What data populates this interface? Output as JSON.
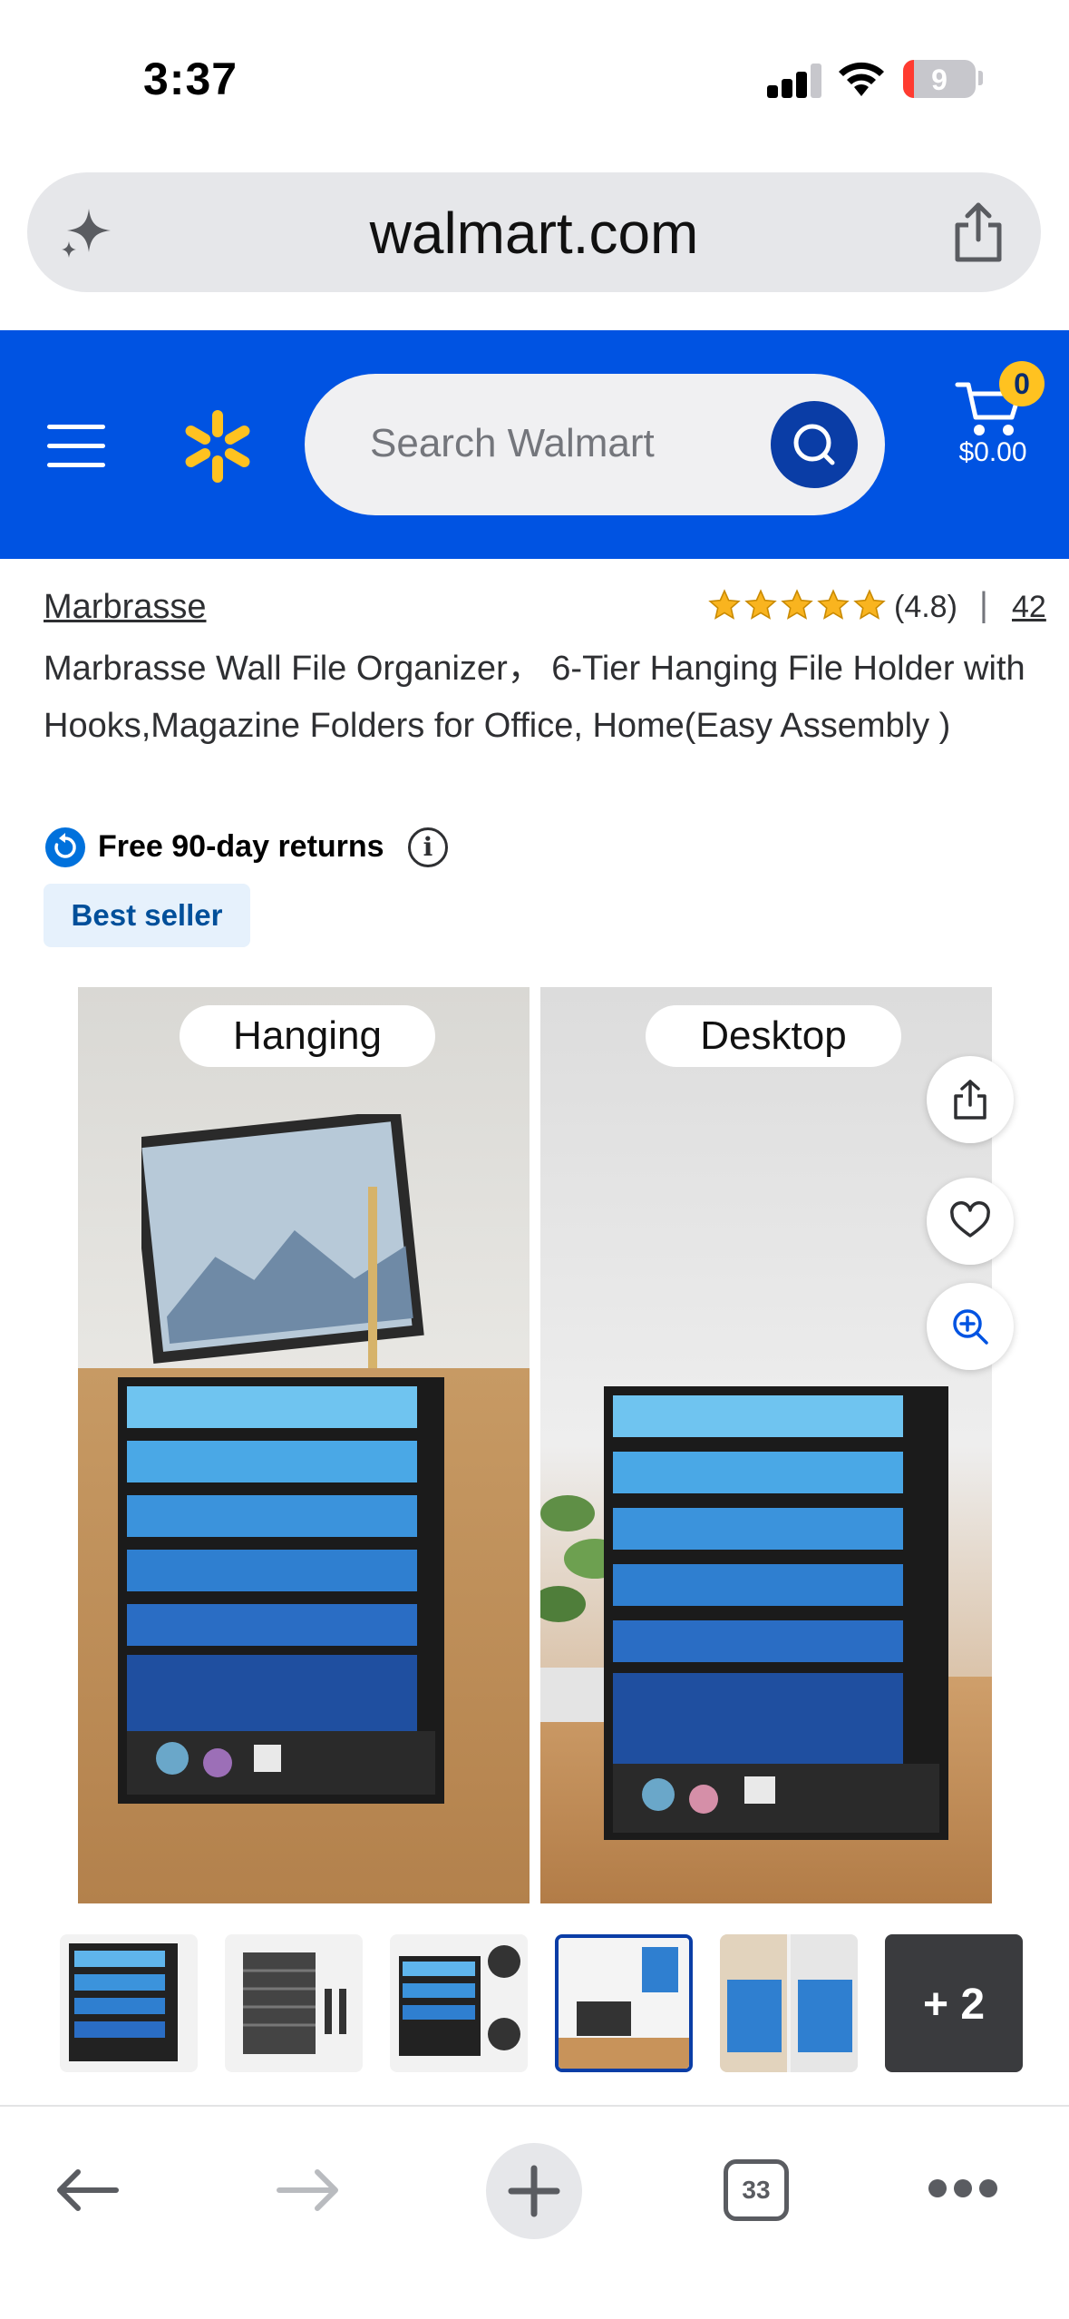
{
  "status_bar": {
    "time": "3:37",
    "battery_level": "9"
  },
  "browser": {
    "url": "walmart.com"
  },
  "header": {
    "search_placeholder": "Search Walmart",
    "cart_count": "0",
    "cart_total": "$0.00",
    "brand_color": "#0053e2",
    "spark_color": "#ffc220"
  },
  "product": {
    "brand": "Marbrasse",
    "rating_stars": 5,
    "rating_value": "(4.8)",
    "separator": "|",
    "review_count": "42",
    "title": "Marbrasse Wall File Organizer， 6-Tier Hanging File Holder with Hooks,Magazine Folders for Office, Home(Easy Assembly )",
    "returns_label": "Free 90-day returns",
    "info_glyph": "i",
    "badge": "Best seller"
  },
  "gallery": {
    "label_left": "Hanging",
    "label_right": "Desktop",
    "thumbnails_more": "+ 2",
    "selected_thumbnail": 4
  },
  "toolbar": {
    "tab_count": "33"
  }
}
